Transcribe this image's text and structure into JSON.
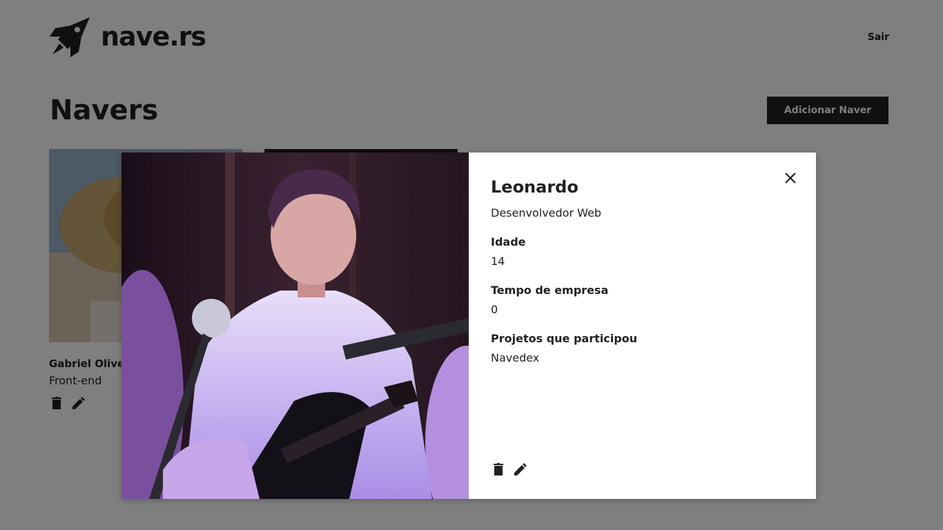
{
  "header": {
    "brand": "nave.rs",
    "logout_label": "Sair"
  },
  "page": {
    "title": "Navers",
    "add_button_label": "Adicionar Naver"
  },
  "cards": [
    {
      "name": "Gabriel Olive",
      "role": "Front-end"
    },
    {
      "name": "",
      "role": ""
    }
  ],
  "modal": {
    "name": "Leonardo",
    "role": "Desenvolvedor Web",
    "fields": [
      {
        "label": "Idade",
        "value": "14"
      },
      {
        "label": "Tempo de empresa",
        "value": "0"
      },
      {
        "label": "Projetos que participou",
        "value": "Navedex"
      }
    ]
  },
  "icons": {
    "logo": "rocket-icon",
    "delete": "trash-icon",
    "edit": "pencil-icon",
    "close": "close-icon"
  },
  "colors": {
    "text": "#212121",
    "button_bg": "#212121",
    "button_text": "#ffffff",
    "overlay": "rgba(0,0,0,0.5)"
  }
}
